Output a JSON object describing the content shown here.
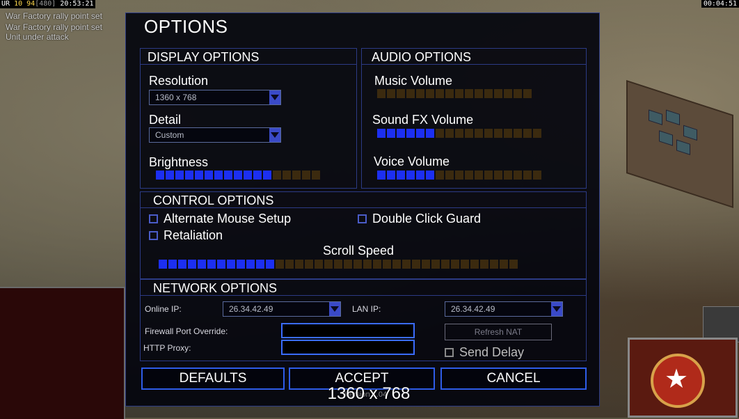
{
  "hud": {
    "prefix": "UR",
    "level": "10",
    "money": "94",
    "money_sub": "[480]",
    "time_left": "20:53:21",
    "time_right": "00:04:51",
    "messages": [
      "War Factory rally point set",
      "War Factory rally point set",
      "Unit under attack"
    ]
  },
  "options": {
    "title": "OPTIONS",
    "display": {
      "title": "DISPLAY OPTIONS",
      "resolution_label": "Resolution",
      "resolution_value": "1360 x 768",
      "detail_label": "Detail",
      "detail_value": "Custom",
      "brightness_label": "Brightness",
      "brightness": {
        "filled": 12,
        "total": 17
      }
    },
    "audio": {
      "title": "AUDIO OPTIONS",
      "music_label": "Music Volume",
      "music": {
        "filled": 0,
        "total": 16
      },
      "sfx_label": "Sound FX Volume",
      "sfx": {
        "filled": 6,
        "total": 17
      },
      "voice_label": "Voice Volume",
      "voice": {
        "filled": 6,
        "total": 17
      }
    },
    "control": {
      "title": "CONTROL OPTIONS",
      "alt_mouse_label": "Alternate Mouse Setup",
      "double_click_label": "Double Click Guard",
      "retaliation_label": "Retaliation",
      "scroll_label": "Scroll Speed",
      "scroll": {
        "filled": 12,
        "total": 37
      }
    },
    "network": {
      "title": "NETWORK OPTIONS",
      "online_ip_label": "Online IP:",
      "online_ip_value": "26.34.42.49",
      "lan_ip_label": "LAN IP:",
      "lan_ip_value": "26.34.42.49",
      "firewall_label": "Firewall Port Override:",
      "http_proxy_label": "HTTP Proxy:",
      "refresh_nat_label": "Refresh NAT",
      "send_delay_label": "Send Delay"
    },
    "buttons": {
      "defaults": "DEFAULTS",
      "accept": "ACCEPT",
      "cancel": "CANCEL"
    }
  },
  "overlay": {
    "resolution_text": "1360 x 768",
    "ghost_text": "Version 1.04"
  }
}
